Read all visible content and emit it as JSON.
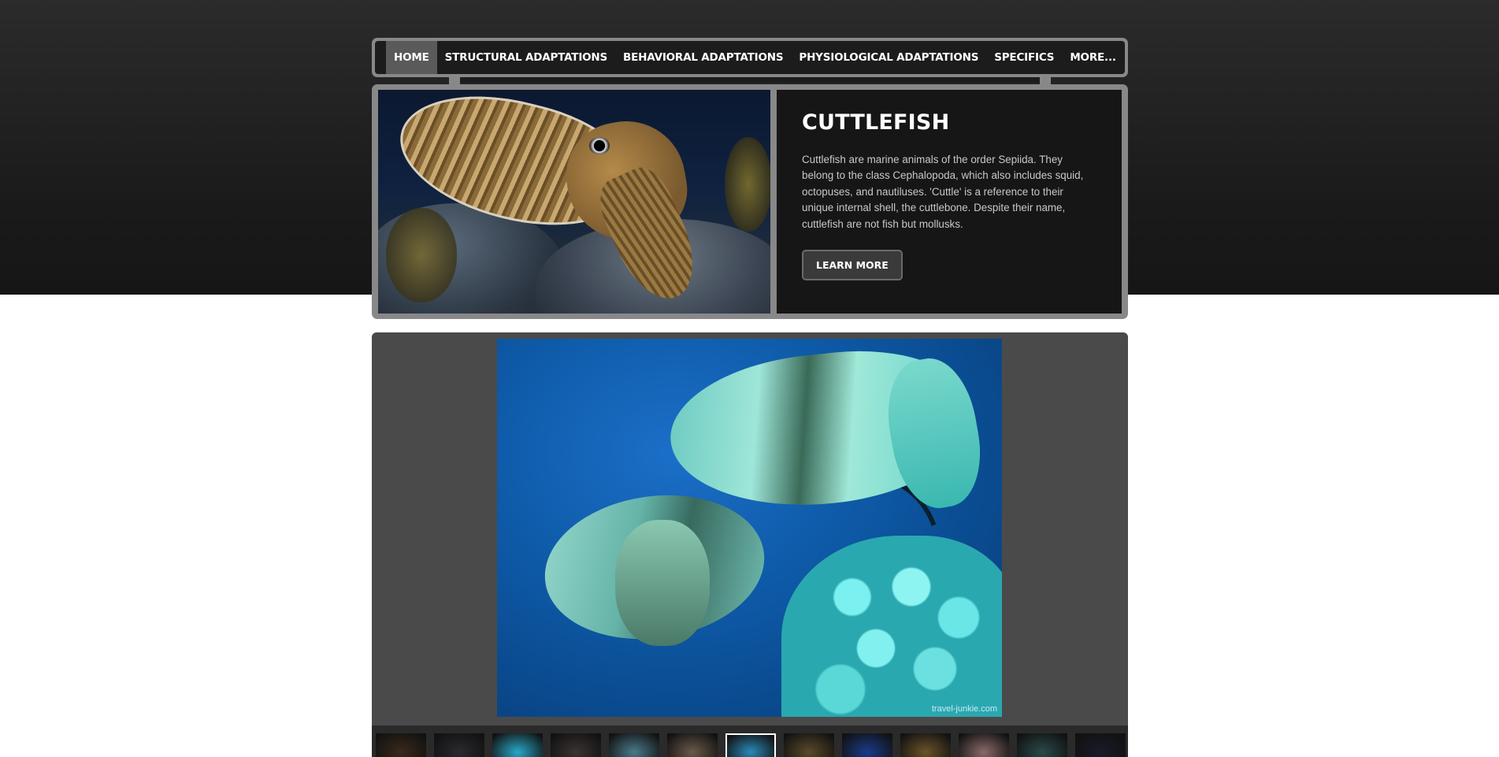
{
  "nav": {
    "items": [
      {
        "label": "HOME",
        "active": true
      },
      {
        "label": "STRUCTURAL ADAPTATIONS"
      },
      {
        "label": "BEHAVIORAL ADAPTATIONS"
      },
      {
        "label": "PHYSIOLOGICAL ADAPTATIONS"
      },
      {
        "label": "SPECIFICS"
      }
    ],
    "more": "MORE..."
  },
  "hero": {
    "title": "CUTTLEFISH",
    "description": "Cuttlefish are marine animals of the order Sepiida. They belong to the class Cephalopoda, which also includes squid, octopuses, and nautiluses. 'Cuttle' is a reference to their unique internal shell, the cuttlebone. Despite their name, cuttlefish are not fish but mollusks.",
    "button": "LEARN MORE"
  },
  "gallery": {
    "watermark": "travel-junkie.com",
    "active_thumb": 7,
    "thumb_count": 14,
    "thumb_colors": [
      "#3a2a1a",
      "#2a2a30",
      "#28a8c8",
      "#3a3432",
      "#4a7a8a",
      "#6a5a4a",
      "#2a8ab8",
      "#5a4a2a",
      "#1a3a8a",
      "#6a5428",
      "#8a6a6a",
      "#2a4a4a",
      "#1a1a2a",
      "#101820"
    ]
  }
}
